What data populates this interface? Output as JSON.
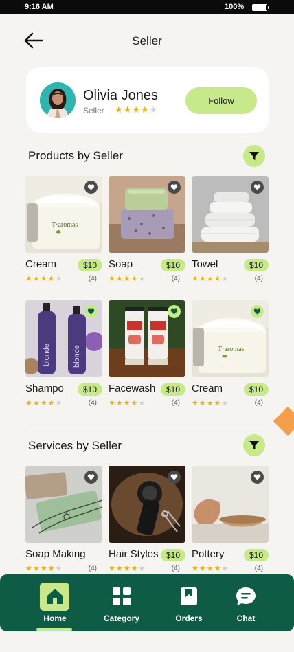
{
  "status": {
    "time": "9:16 AM",
    "battery": "100%"
  },
  "header": {
    "title": "Seller"
  },
  "seller": {
    "name": "Olivia Jones",
    "role": "Seller",
    "rating": 4,
    "follow_label": "Follow"
  },
  "products": {
    "title": "Products by Seller",
    "items": [
      {
        "name": "Cream",
        "price": "$10",
        "rating": 4,
        "count": "(4)",
        "liked": false,
        "image": "cream-jar"
      },
      {
        "name": "Soap",
        "price": "$10",
        "rating": 4,
        "count": "(4)",
        "liked": false,
        "image": "soap-bar"
      },
      {
        "name": "Towel",
        "price": "$10",
        "rating": 4,
        "count": "(4)",
        "liked": false,
        "image": "towels"
      },
      {
        "name": "Shampo",
        "price": "$10",
        "rating": 4,
        "count": "(4)",
        "liked": true,
        "image": "shampoo-bottles"
      },
      {
        "name": "Facewash",
        "price": "$10",
        "rating": 4,
        "count": "(4)",
        "liked": true,
        "image": "facewash-tubes"
      },
      {
        "name": "Cream",
        "price": "$10",
        "rating": 4,
        "count": "(4)",
        "liked": true,
        "image": "cream-jar"
      }
    ]
  },
  "services": {
    "title": "Services by Seller",
    "items": [
      {
        "name": "Soap Making",
        "price": "$10",
        "rating": 4,
        "count": "(4)",
        "liked": false,
        "image": "handmade-soap"
      },
      {
        "name": "Hair Styles",
        "price": "$10",
        "rating": 4,
        "count": "(4)",
        "liked": false,
        "image": "hair-clipper"
      },
      {
        "name": "Pottery",
        "price": "$10",
        "rating": 4,
        "count": "(4)",
        "liked": false,
        "image": "pottery-bowls"
      }
    ]
  },
  "nav": {
    "items": [
      {
        "label": "Home",
        "icon": "home-icon",
        "active": true
      },
      {
        "label": "Category",
        "icon": "grid-icon",
        "active": false
      },
      {
        "label": "Orders",
        "icon": "bookmark-icon",
        "active": false
      },
      {
        "label": "Chat",
        "icon": "chat-icon",
        "active": false
      }
    ]
  },
  "colors": {
    "accent": "#c7e98a",
    "nav_bg": "#0f5c46",
    "star": "#e6b418",
    "background": "#f5f4f0"
  }
}
